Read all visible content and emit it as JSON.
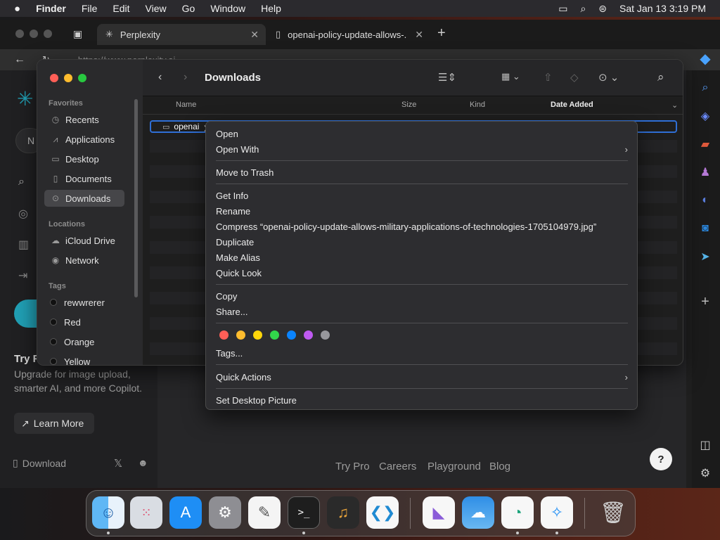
{
  "menubar": {
    "apple": "",
    "app": "Finder",
    "items": [
      "File",
      "Edit",
      "View",
      "Go",
      "Window",
      "Help"
    ],
    "datetime": "Sat Jan 13  3:19 PM"
  },
  "browser": {
    "tabs": [
      {
        "label": "Perplexity"
      },
      {
        "label": "openai-policy-update-allows-..."
      }
    ],
    "address": "https://www.perplexity.ai",
    "sidebar": {
      "try_pro_title": "Try F",
      "upgrade_text": "Upgrade for image upload, smarter AI, and more Copilot.",
      "learn_more": "Learn More",
      "download": "Download",
      "partial_letter": "N"
    },
    "footer_links": [
      "Try Pro",
      "Careers",
      "Playground",
      "Blog"
    ],
    "help": "?"
  },
  "finder": {
    "title": "Downloads",
    "sidebar": {
      "favorites_header": "Favorites",
      "favorites": [
        {
          "label": "Recents",
          "icon": "clock-icon"
        },
        {
          "label": "Applications",
          "icon": "applications-icon"
        },
        {
          "label": "Desktop",
          "icon": "desktop-icon"
        },
        {
          "label": "Documents",
          "icon": "document-icon"
        },
        {
          "label": "Downloads",
          "icon": "download-icon",
          "selected": true
        }
      ],
      "locations_header": "Locations",
      "locations": [
        {
          "label": "iCloud Drive",
          "icon": "cloud-icon"
        },
        {
          "label": "Network",
          "icon": "globe-icon"
        }
      ],
      "tags_header": "Tags",
      "tags": [
        {
          "label": "rewwrerer",
          "color": "#111111"
        },
        {
          "label": "Red",
          "color": "#111111"
        },
        {
          "label": "Orange",
          "color": "#111111"
        },
        {
          "label": "Yellow",
          "color": "#111111"
        }
      ]
    },
    "columns": [
      "Name",
      "Size",
      "Kind",
      "Date Added"
    ],
    "selected_file": "openai"
  },
  "context_menu": {
    "items": {
      "open": "Open",
      "open_with": "Open With",
      "move_to_trash": "Move to Trash",
      "get_info": "Get Info",
      "rename": "Rename",
      "compress": "Compress “openai-policy-update-allows-military-applications-of-technologies-1705104979.jpg”",
      "duplicate": "Duplicate",
      "make_alias": "Make Alias",
      "quick_look": "Quick Look",
      "copy": "Copy",
      "share": "Share...",
      "tags": "Tags...",
      "quick_actions": "Quick Actions",
      "set_desktop": "Set Desktop Picture"
    },
    "tag_colors": [
      "#ff5f57",
      "#febc2e",
      "#ffd60a",
      "#32d74b",
      "#0a84ff",
      "#bf5af2",
      "#98989d"
    ]
  },
  "dock": {
    "apps": [
      "Finder",
      "Launchpad",
      "App Store",
      "System Settings",
      "TextEdit",
      "Terminal",
      "GarageBand",
      "Visual Studio Code",
      "Visual Studio",
      "Weather",
      "Microsoft Edge",
      "Safari",
      "Trash"
    ]
  }
}
